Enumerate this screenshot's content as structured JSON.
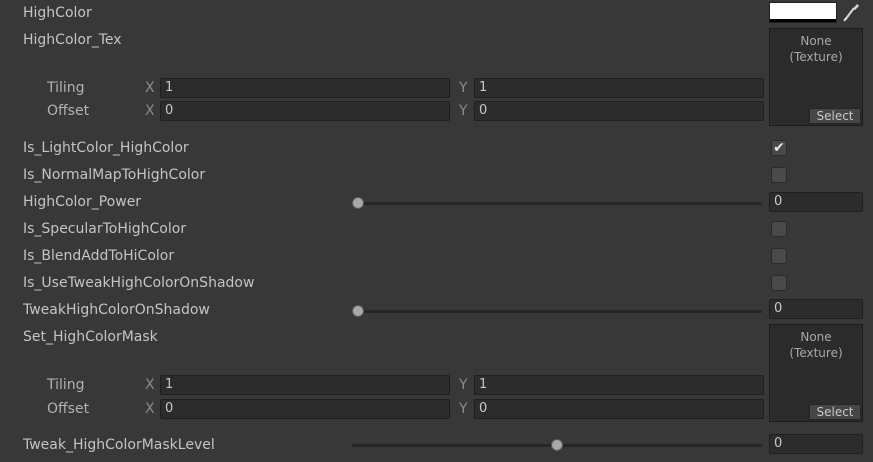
{
  "high_color": {
    "label": "HighColor",
    "color": "#ffffff"
  },
  "high_color_tex": {
    "label": "HighColor_Tex",
    "tiling_label": "Tiling",
    "offset_label": "Offset",
    "axis_x": "X",
    "axis_y": "Y",
    "tiling_x": "1",
    "tiling_y": "1",
    "offset_x": "0",
    "offset_y": "0",
    "texture_value": "None\n(Texture)",
    "select_label": "Select"
  },
  "toggles": {
    "is_lightcolor_highcolor": {
      "label": "Is_LightColor_HighColor",
      "checked": true,
      "mark": "✔"
    },
    "is_normalmap_to_highcolor": {
      "label": "Is_NormalMapToHighColor",
      "checked": false,
      "mark": ""
    },
    "is_specular_to_highcolor": {
      "label": "Is_SpecularToHighColor",
      "checked": false,
      "mark": ""
    },
    "is_blendadd_to_hicolor": {
      "label": "Is_BlendAddToHiColor",
      "checked": false,
      "mark": ""
    },
    "is_use_tweak_highcolor_on_shadow": {
      "label": "Is_UseTweakHighColorOnShadow",
      "checked": false,
      "mark": ""
    }
  },
  "sliders": {
    "highcolor_power": {
      "label": "HighColor_Power",
      "value": "0",
      "fraction": 0
    },
    "tweak_highcolor_on_shadow": {
      "label": "TweakHighColorOnShadow",
      "value": "0",
      "fraction": 0
    },
    "tweak_highcolor_mask_level": {
      "label": "Tweak_HighColorMaskLevel",
      "value": "0",
      "fraction": 0.5
    }
  },
  "set_highcolor_mask": {
    "label": "Set_HighColorMask",
    "tiling_label": "Tiling",
    "offset_label": "Offset",
    "axis_x": "X",
    "axis_y": "Y",
    "tiling_x": "1",
    "tiling_y": "1",
    "offset_x": "0",
    "offset_y": "0",
    "texture_value": "None\n(Texture)",
    "select_label": "Select"
  }
}
